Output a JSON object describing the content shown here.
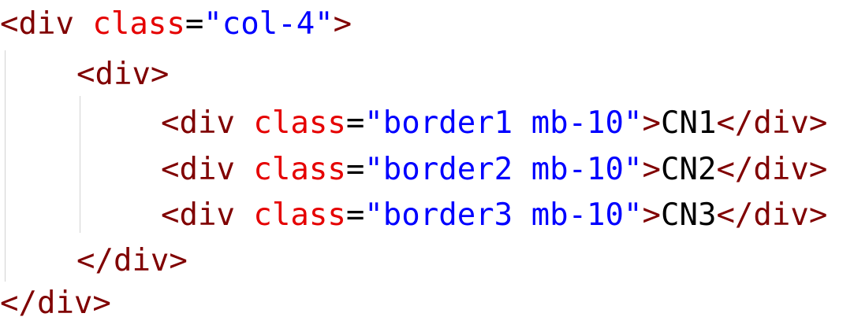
{
  "code": {
    "line1": {
      "open": "<div",
      "attr": "class",
      "eq": "=",
      "value": "\"col-4\"",
      "close": ">"
    },
    "line2": {
      "tag": "<div>"
    },
    "items": [
      {
        "open": "<div",
        "attr": "class",
        "eq": "=",
        "value": "\"border1 mb-10\"",
        "gt": ">",
        "text": "CN1",
        "end": "</div>"
      },
      {
        "open": "<div",
        "attr": "class",
        "eq": "=",
        "value": "\"border2 mb-10\"",
        "gt": ">",
        "text": "CN2",
        "end": "</div>"
      },
      {
        "open": "<div",
        "attr": "class",
        "eq": "=",
        "value": "\"border3 mb-10\"",
        "gt": ">",
        "text": "CN3",
        "end": "</div>"
      }
    ],
    "line6": {
      "tag": "</div>"
    },
    "line7": {
      "tag": "</div>"
    }
  },
  "colors": {
    "tag": "#800000",
    "attribute": "#e50000",
    "string": "#0000ff",
    "text": "#000000",
    "indent_guide": "#d3d3d3"
  }
}
